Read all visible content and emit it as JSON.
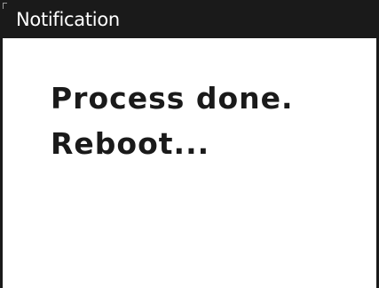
{
  "dialog": {
    "title": "Notification",
    "message_lines": [
      "Process done.",
      "Reboot..."
    ]
  }
}
